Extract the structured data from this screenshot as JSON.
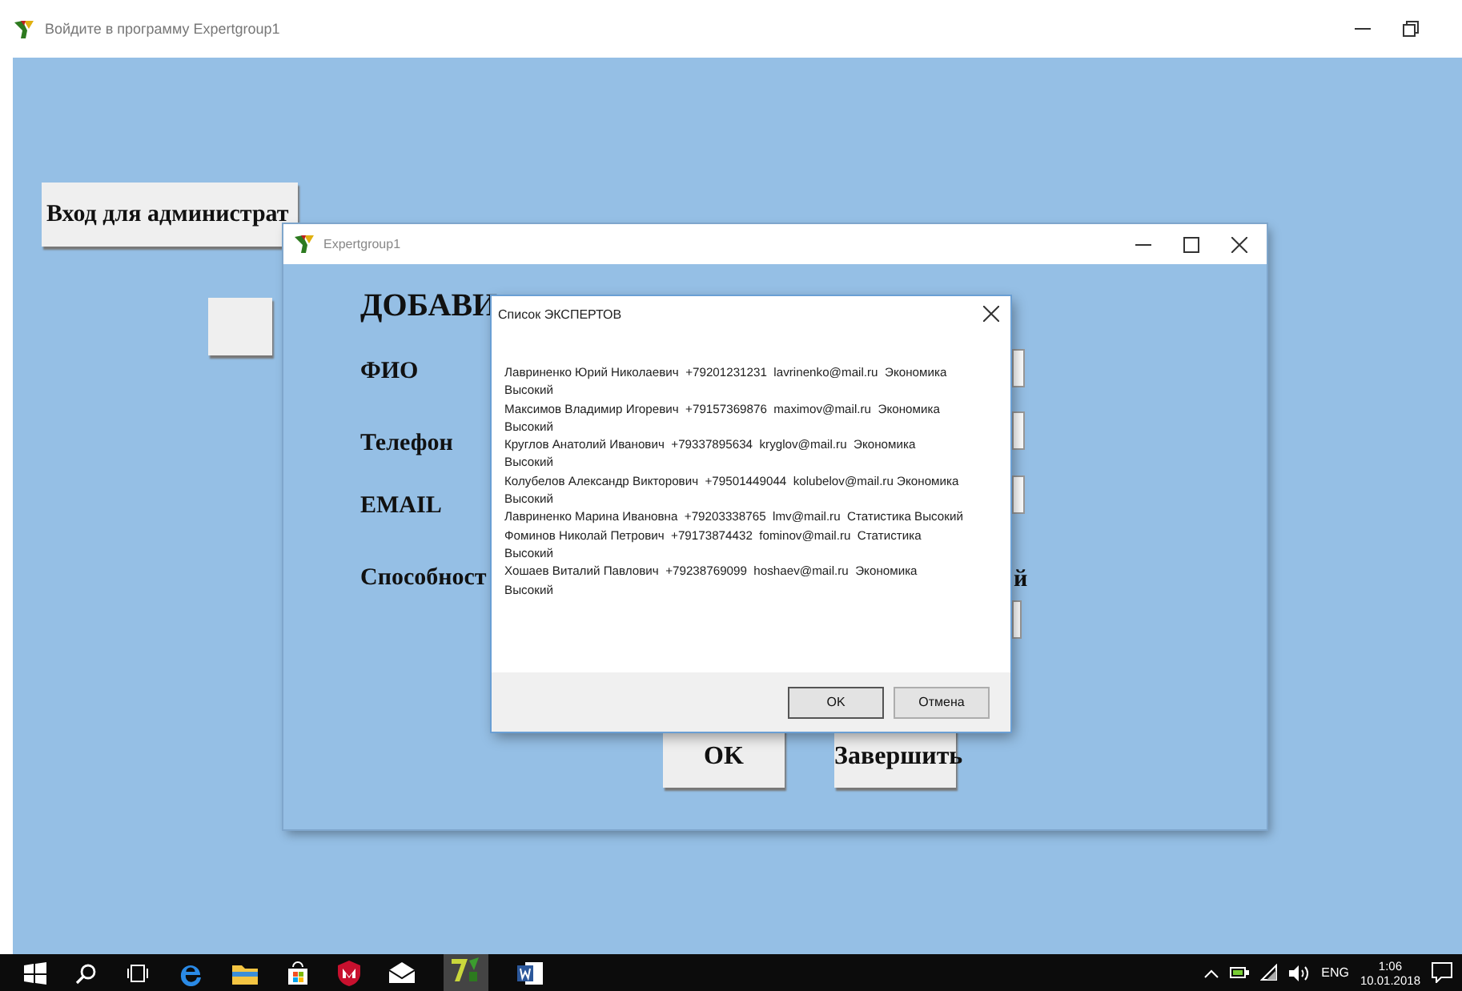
{
  "main_window": {
    "title": "Войдите в программу Expertgroup1",
    "admin_button": "Вход для администрат"
  },
  "form_window": {
    "title": "Expertgroup1",
    "heading": "ДОБАВИ",
    "labels": [
      "ФИО",
      "Телефон",
      "EMAIL",
      "Способност"
    ],
    "side_text": "й",
    "buttons": [
      "OK",
      "Завершить"
    ]
  },
  "dialog": {
    "title": "Список ЭКСПЕРТОВ",
    "experts": [
      "Лавриненко Юрий Николаевич  +79201231231  lavrinenko@mail.ru  Экономика  Высокий",
      "Максимов Владимир Игоревич  +79157369876  maximov@mail.ru  Экономика Высокий",
      "Круглов Анатолий Иванович  +79337895634  kryglov@mail.ru  Экономика Высокий",
      "Колубелов Александр Викторович  +79501449044  kolubelov@mail.ru Экономика  Высокий",
      "Лавриненко Марина Ивановна  +79203338765  lmv@mail.ru  Статистика Высокий",
      "Фоминов Николай Петрович  +79173874432  fominov@mail.ru  Статистика Высокий",
      "Хошаев Виталий Павлович  +79238769099  hoshaev@mail.ru  Экономика Высокий"
    ],
    "buttons": [
      "OK",
      "Отмена"
    ]
  },
  "taskbar": {
    "language": "ENG",
    "time": "1:06",
    "date": "10.01.2018"
  }
}
